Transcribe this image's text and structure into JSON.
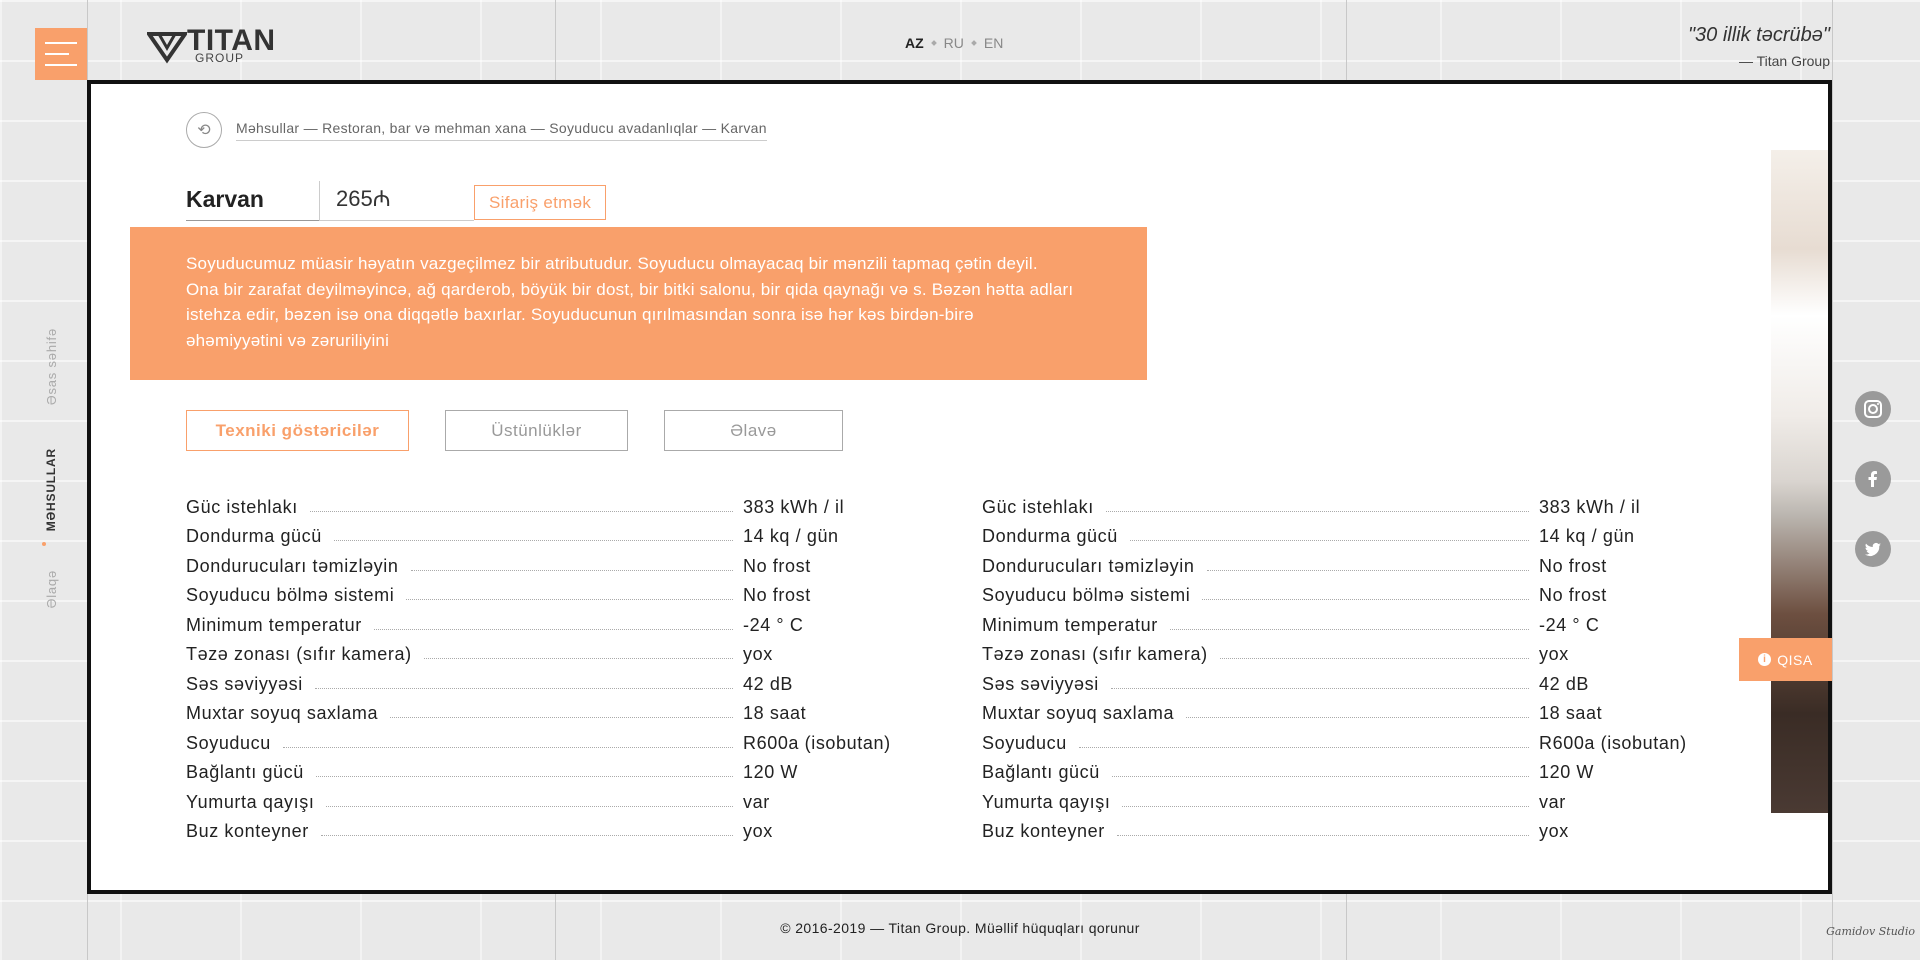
{
  "header": {
    "logo_text": "TITAN",
    "logo_sub": "GROUP",
    "languages": [
      {
        "code": "AZ",
        "active": true
      },
      {
        "code": "RU",
        "active": false
      },
      {
        "code": "EN",
        "active": false
      }
    ],
    "quote_text": "\"30 illik təcrübə\"",
    "quote_author": "— Titan Group"
  },
  "left_nav": {
    "items": [
      "Əsas səhifə",
      "MƏHSULLAR",
      "Əlaqə"
    ]
  },
  "breadcrumb": "Məhsullar — Restoran, bar və mehman xana — Soyuducu avadanlıqlar — Karvan",
  "product": {
    "name": "Karvan",
    "price": "265₼",
    "order_label": "Sifariş etmək",
    "description": "Soyuducumuz müasir həyatın vazgeçilmez bir atributudur. Soyuducu olmayacaq bir mənzili tapmaq çətin deyil. Ona bir zarafat deyilməyincə, ağ qarderob, böyük bir dost, bir bitki salonu, bir qida qaynağı və s. Bəzən hətta adları istehza edir, bəzən isə ona diqqətlə baxırlar. Soyuducunun qırılmasından sonra isə hər kəs birdən-birə əhəmiyyətini və zəruriliyini"
  },
  "tabs": [
    {
      "label": "Texniki göstəricilər",
      "active": true
    },
    {
      "label": "Üstünlüklər",
      "active": false
    },
    {
      "label": "Əlavə",
      "active": false
    }
  ],
  "specs_left": [
    {
      "label": "Güc istehlakı",
      "value": "383 kWh / il"
    },
    {
      "label": "Dondurma gücü",
      "value": "14 kq / gün"
    },
    {
      "label": "Dondurucuları təmizləyin",
      "value": "No frost"
    },
    {
      "label": "Soyuducu bölmə sistemi",
      "value": "No frost"
    },
    {
      "label": "Minimum temperatur",
      "value": "-24 ° C"
    },
    {
      "label": "Təzə zonası (sıfır kamera)",
      "value": "yox"
    },
    {
      "label": "Səs səviyyəsi",
      "value": "42 dB"
    },
    {
      "label": "Muxtar soyuq saxlama",
      "value": "18 saat"
    },
    {
      "label": "Soyuducu",
      "value": "R600a (isobutan)"
    },
    {
      "label": "Bağlantı gücü",
      "value": "120 W"
    },
    {
      "label": "Yumurta qayışı",
      "value": "var"
    },
    {
      "label": "Buz konteyner",
      "value": "yox"
    }
  ],
  "specs_right": [
    {
      "label": "Güc istehlakı",
      "value": "383 kWh / il"
    },
    {
      "label": "Dondurma gücü",
      "value": "14 kq / gün"
    },
    {
      "label": "Dondurucuları təmizləyin",
      "value": "No frost"
    },
    {
      "label": "Soyuducu bölmə sistemi",
      "value": "No frost"
    },
    {
      "label": "Minimum temperatur",
      "value": "-24 ° C"
    },
    {
      "label": "Təzə zonası (sıfır kamera)",
      "value": "yox"
    },
    {
      "label": "Səs səviyyəsi",
      "value": "42 dB"
    },
    {
      "label": "Muxtar soyuq saxlama",
      "value": "18 saat"
    },
    {
      "label": "Soyuducu",
      "value": "R600a (isobutan)"
    },
    {
      "label": "Bağlantı gücü",
      "value": "120 W"
    },
    {
      "label": "Yumurta qayışı",
      "value": "var"
    },
    {
      "label": "Buz konteyner",
      "value": "yox"
    }
  ],
  "qisa_label": "QISA",
  "social": [
    "instagram-icon",
    "facebook-icon",
    "twitter-icon"
  ],
  "footer": "© 2016-2019 — Titan Group. Müəllif hüquqları qorunur",
  "signature": "Gamidov Studio",
  "colors": {
    "accent": "#f9a06b",
    "frame": "#111111",
    "background": "#e9e9e9"
  }
}
